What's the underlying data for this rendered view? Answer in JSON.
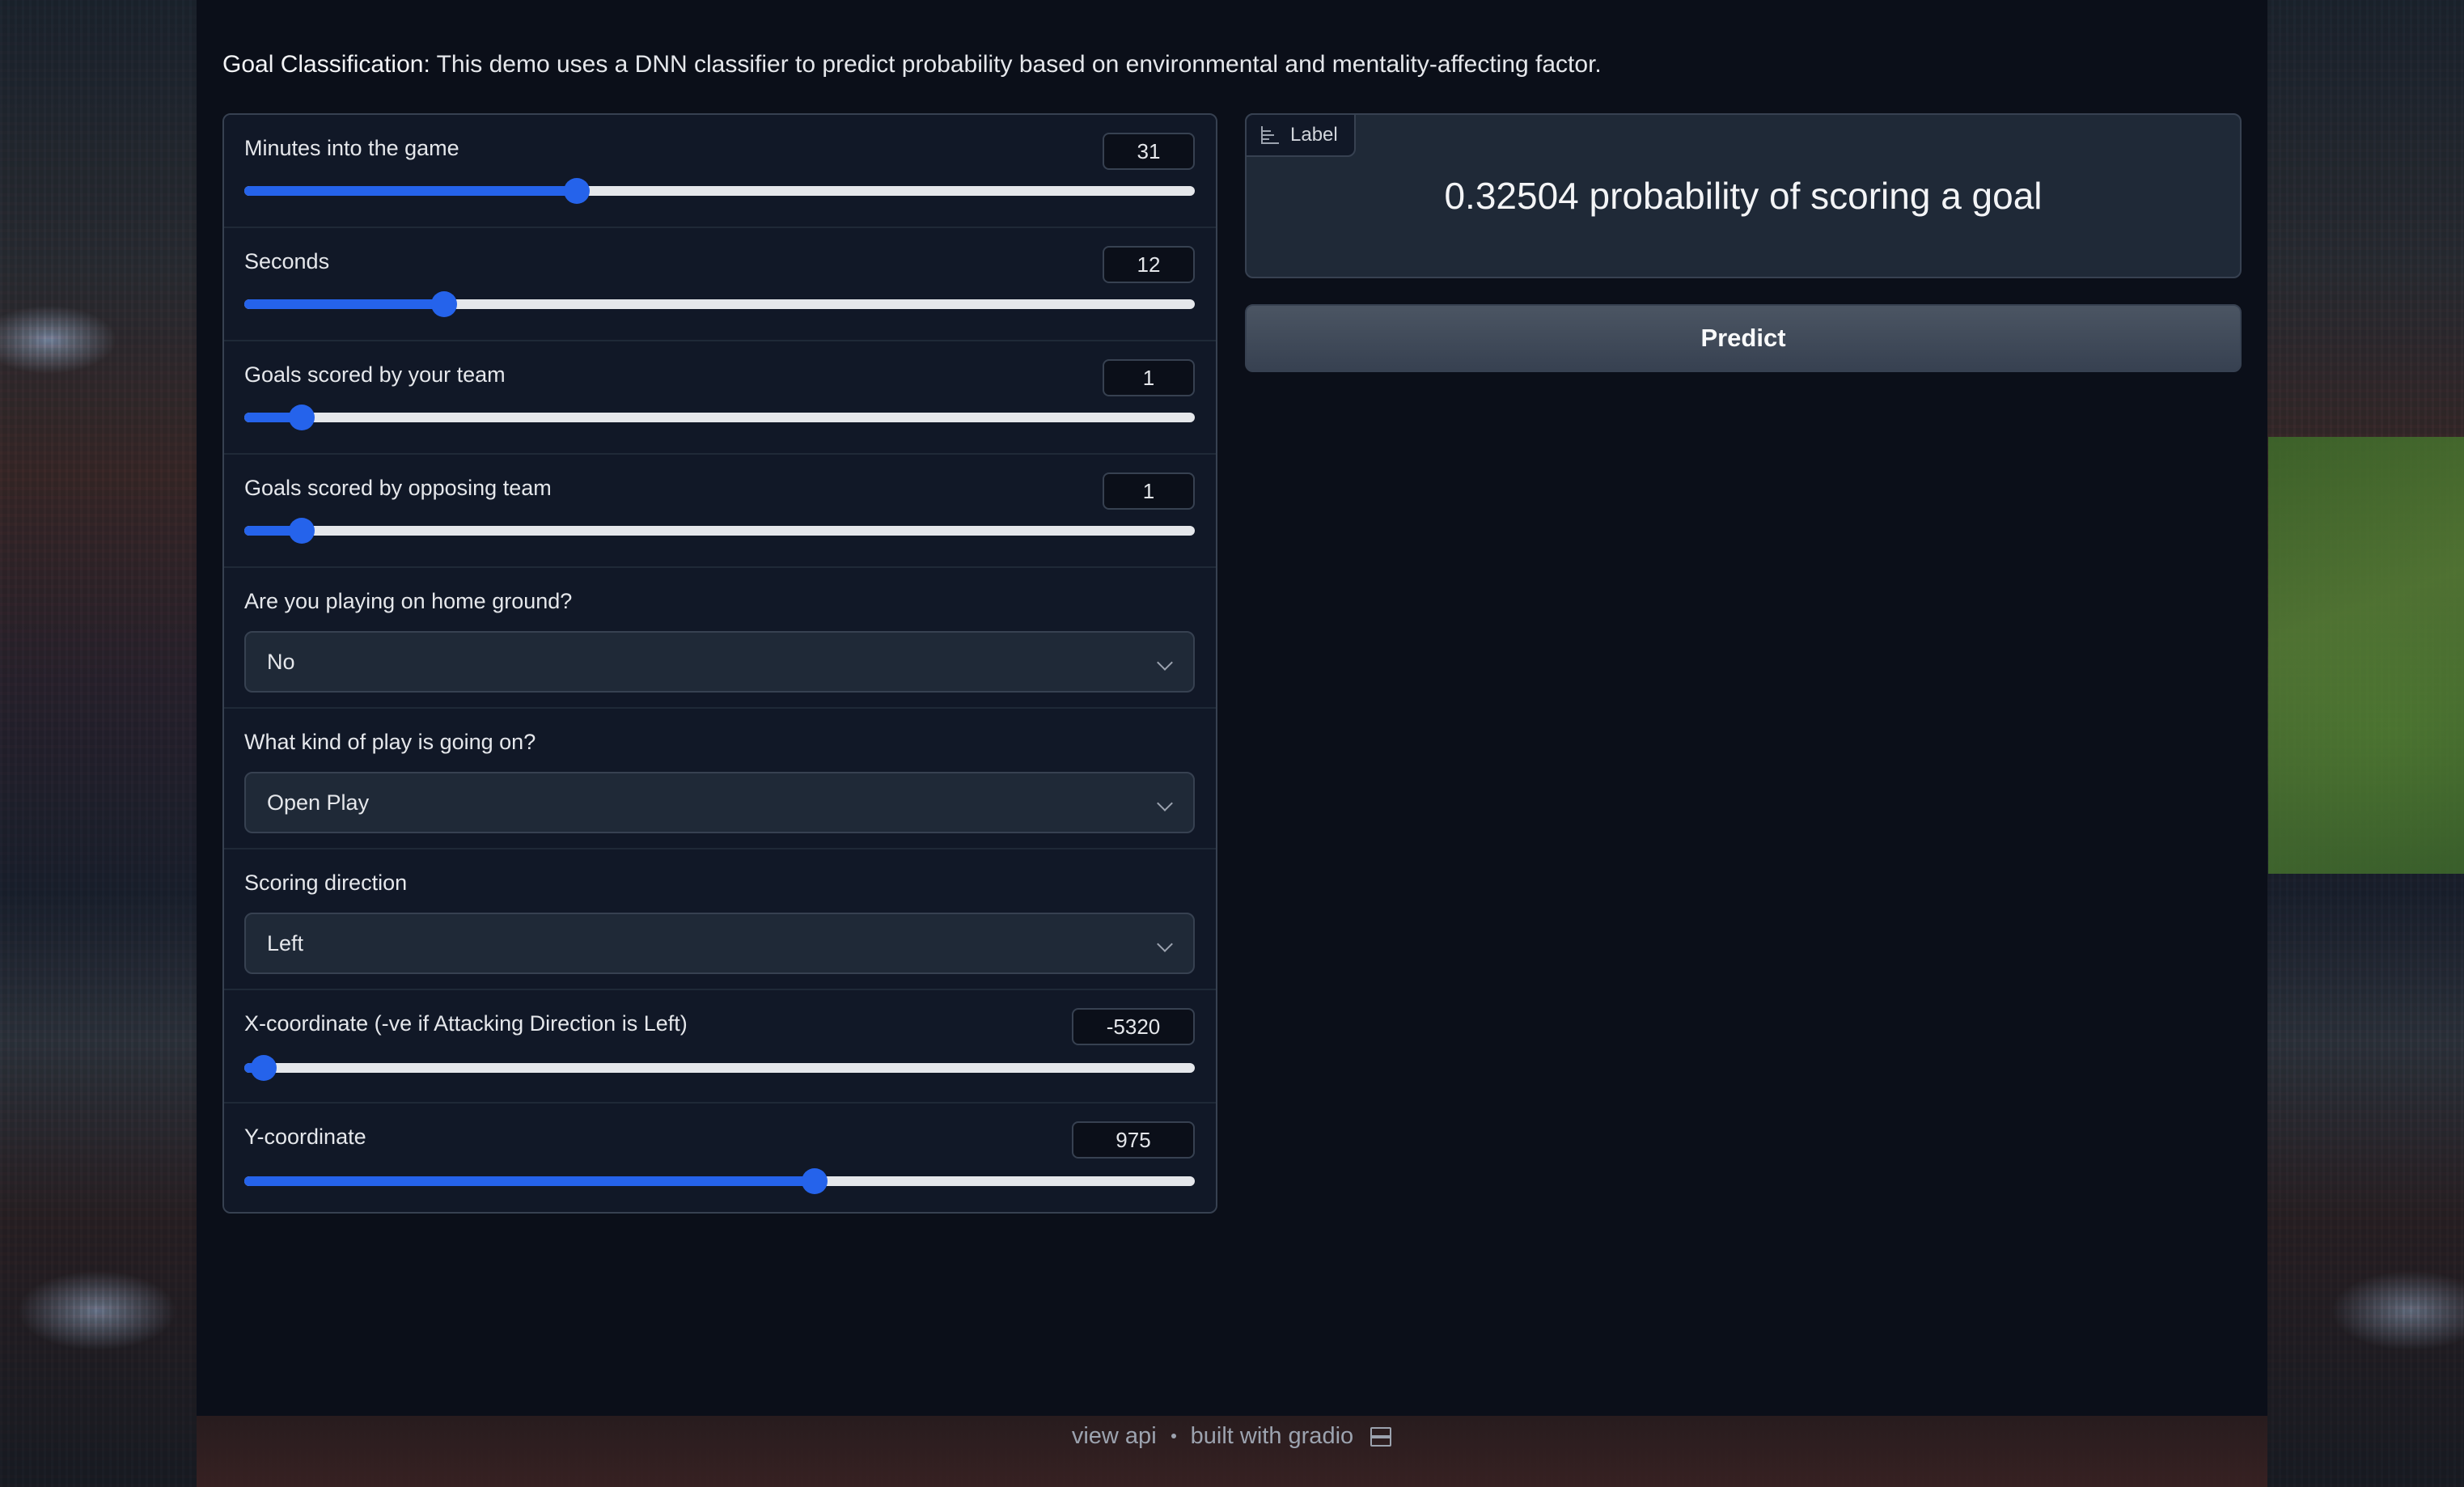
{
  "description": {
    "title": "Goal Classification:",
    "text": " This demo uses a DNN classifier to predict probability based on environmental and mentality-affecting factor."
  },
  "inputs": {
    "minutes": {
      "label": "Minutes into the game",
      "value": "31",
      "fill_fraction": 0.35
    },
    "seconds": {
      "label": "Seconds",
      "value": "12",
      "fill_fraction": 0.21
    },
    "goals_yours": {
      "label": "Goals scored by your team",
      "value": "1",
      "fill_fraction": 0.06
    },
    "goals_opposing": {
      "label": "Goals scored by opposing team",
      "value": "1",
      "fill_fraction": 0.06
    },
    "home_ground": {
      "label": "Are you playing on home ground?",
      "value": "No"
    },
    "play_type": {
      "label": "What kind of play is going on?",
      "value": "Open Play"
    },
    "scoring_direction": {
      "label": "Scoring direction",
      "value": "Left"
    },
    "x_coordinate": {
      "label": "X-coordinate (-ve if Attacking Direction is Left)",
      "value": "-5320",
      "fill_fraction": 0.02
    },
    "y_coordinate": {
      "label": "Y-coordinate",
      "value": "975",
      "fill_fraction": 0.6
    }
  },
  "output": {
    "tag": "Label",
    "result": "0.32504 probability of scoring a goal"
  },
  "predict_button": "Predict",
  "footer": {
    "api": "view api",
    "built": "built with gradio"
  },
  "colors": {
    "accent": "#2563eb",
    "panel": "#1f2937",
    "background": "#0b0f19"
  }
}
